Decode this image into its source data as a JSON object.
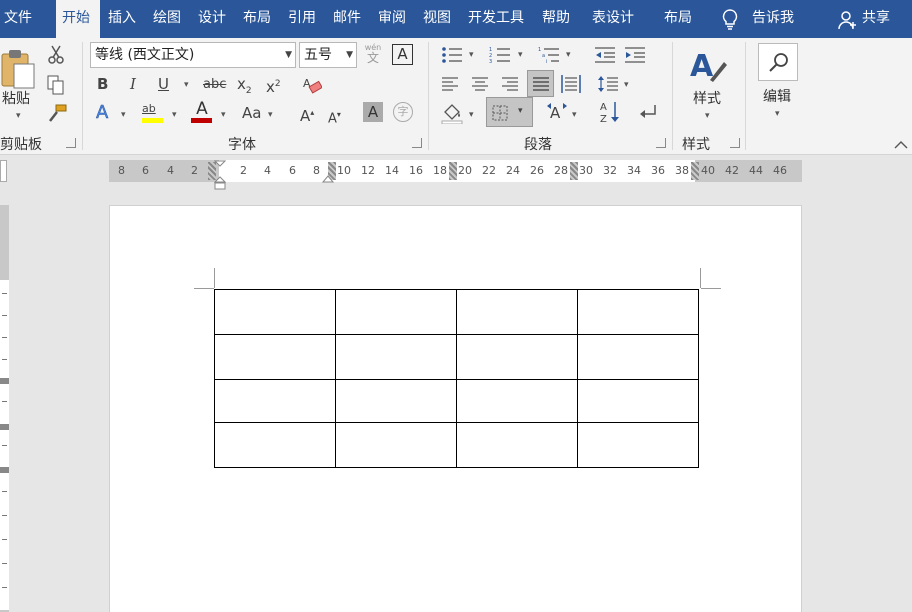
{
  "tabs": [
    {
      "label": "文件"
    },
    {
      "label": "开始"
    },
    {
      "label": "插入"
    },
    {
      "label": "绘图"
    },
    {
      "label": "设计"
    },
    {
      "label": "布局"
    },
    {
      "label": "引用"
    },
    {
      "label": "邮件"
    },
    {
      "label": "审阅"
    },
    {
      "label": "视图"
    },
    {
      "label": "开发工具"
    },
    {
      "label": "帮助"
    },
    {
      "label": "表设计"
    },
    {
      "label": "布局"
    }
  ],
  "tell_me": "告诉我",
  "share": "共享",
  "clipboard": {
    "paste_label": "粘贴",
    "group_label": "剪贴板"
  },
  "font": {
    "font_name": "等线 (西文正文)",
    "font_size": "五号",
    "wen_glyph": "wén",
    "wen_glyph2": "文",
    "boxed_a": "A",
    "bold": "B",
    "italic": "I",
    "underline": "U",
    "strike": "abc",
    "sub": "x",
    "sub_mark": "2",
    "sup": "x",
    "sup_mark": "2",
    "effects": "A",
    "highlight": "ab",
    "font_color": "A",
    "case": "Aa",
    "grow": "A",
    "shrink": "A",
    "shade": "A",
    "enclose": "字",
    "group_label": "字体"
  },
  "paragraph": {
    "group_label": "段落"
  },
  "styles": {
    "button_label": "样式",
    "group_label": "样式"
  },
  "editing": {
    "button_label": "编辑"
  },
  "ruler": {
    "left_ticks": [
      "8",
      "6",
      "4",
      "2"
    ],
    "ticks": [
      "2",
      "4",
      "6",
      "8",
      "10",
      "12",
      "14",
      "16",
      "18",
      "20",
      "22",
      "24",
      "26",
      "28",
      "30",
      "32",
      "34",
      "36",
      "38",
      "40",
      "42",
      "44",
      "46"
    ]
  },
  "table": {
    "rows": 4,
    "cols": 4
  },
  "colors": {
    "accent": "#2b579a",
    "highlight_bar": "#ffff00",
    "font_color_bar": "#c00000"
  }
}
